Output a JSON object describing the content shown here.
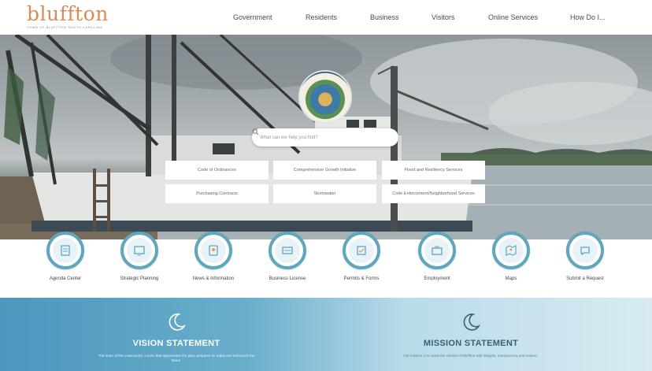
{
  "site": {
    "logo_word": "bluffton",
    "logo_tagline": "town of bluffton south carolina"
  },
  "nav": [
    {
      "label": "Government"
    },
    {
      "label": "Residents"
    },
    {
      "label": "Business"
    },
    {
      "label": "Visitors"
    },
    {
      "label": "Online Services"
    },
    {
      "label": "How Do I..."
    }
  ],
  "search": {
    "placeholder": "What can we help you find?"
  },
  "quick_links": [
    {
      "label": "Code of Ordinances"
    },
    {
      "label": "Comprehensive Growth Initiative"
    },
    {
      "label": "Flood and Resiliency Services"
    },
    {
      "label": "Purchasing Contracts"
    },
    {
      "label": "Stormwater"
    },
    {
      "label": "Code Enforcement/Neighborhood Services"
    }
  ],
  "services": [
    {
      "label": "Agenda Center",
      "icon": "agenda-icon"
    },
    {
      "label": "Strategic Planning",
      "icon": "planning-icon"
    },
    {
      "label": "News & Information",
      "icon": "news-icon"
    },
    {
      "label": "Business License",
      "icon": "license-icon"
    },
    {
      "label": "Permits & Forms",
      "icon": "permits-icon"
    },
    {
      "label": "Employment",
      "icon": "employment-icon"
    },
    {
      "label": "Maps",
      "icon": "maps-icon"
    },
    {
      "label": "Submit a Request",
      "icon": "request-icon"
    }
  ],
  "statements": {
    "vision": {
      "title": "VISION STATEMENT",
      "text": "The heart of the Lowcountry: a town that appreciates the past, prepares for today and embraces the future."
    },
    "mission": {
      "title": "MISSION STATEMENT",
      "text": "Our mission is to serve the citizens of Bluffton with integrity, transparency and respect."
    }
  },
  "colors": {
    "brand_orange": "#d98b54",
    "accent_blue": "#5fa6bf",
    "band_blue": "#4b97bd"
  }
}
